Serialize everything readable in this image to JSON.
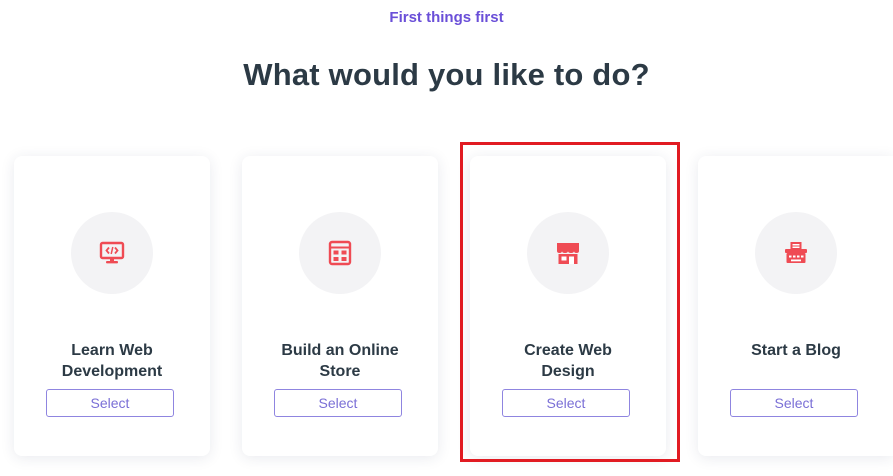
{
  "header": {
    "eyebrow": "First things first",
    "title": "What would you like to do?"
  },
  "cards": [
    {
      "icon": "code-monitor-icon",
      "title_line1": "Learn Web",
      "title_line2": "Development",
      "button": "Select"
    },
    {
      "icon": "store-layout-icon",
      "title_line1": "Build an Online",
      "title_line2": "Store",
      "button": "Select"
    },
    {
      "icon": "storefront-icon",
      "title_line1": "Create Web",
      "title_line2": "Design",
      "button": "Select",
      "highlighted": true
    },
    {
      "icon": "typewriter-icon",
      "title_line1": "Start a Blog",
      "title_line2": "",
      "button": "Select"
    }
  ],
  "colors": {
    "accent": "#6a4fd8",
    "icon": "#ef4b54",
    "heading": "#2c3a45",
    "highlight": "#e11b22",
    "button_border": "#8f85e0"
  }
}
